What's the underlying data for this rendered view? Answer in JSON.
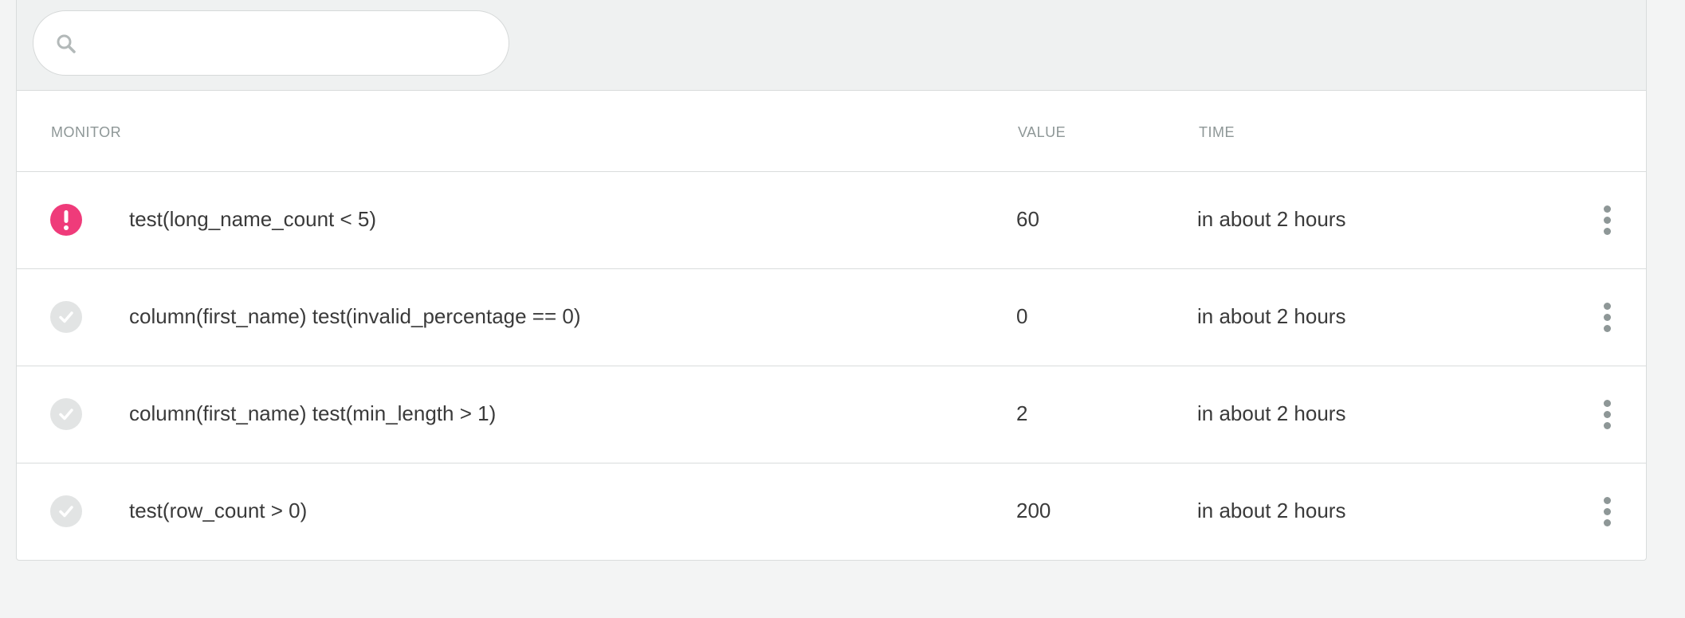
{
  "search": {
    "placeholder": "",
    "value": "",
    "icon": "search-icon"
  },
  "table": {
    "columns": [
      "MONITOR",
      "VALUE",
      "TIME"
    ],
    "rows": [
      {
        "status": "fail",
        "status_icon": "exclamation-icon",
        "name": "test(long_name_count < 5)",
        "value": "60",
        "time": "in about 2 hours"
      },
      {
        "status": "ok",
        "status_icon": "check-icon",
        "name": "column(first_name) test(invalid_percentage == 0)",
        "value": "0",
        "time": "in about 2 hours"
      },
      {
        "status": "ok",
        "status_icon": "check-icon",
        "name": "column(first_name) test(min_length > 1)",
        "value": "2",
        "time": "in about 2 hours"
      },
      {
        "status": "ok",
        "status_icon": "check-icon",
        "name": "test(row_count > 0)",
        "value": "200",
        "time": "in about 2 hours"
      }
    ]
  },
  "colors": {
    "fail": "#ef3b7a",
    "ok": "#e2e4e4",
    "header_text": "#8e9797",
    "body_text": "#3a3a3a"
  }
}
